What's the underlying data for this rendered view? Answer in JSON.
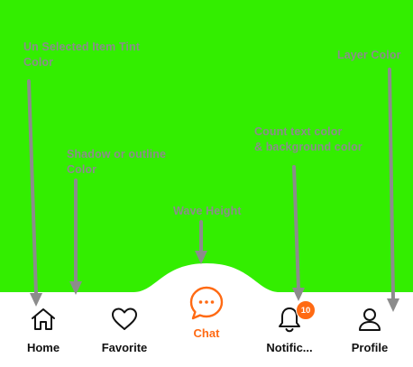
{
  "colors": {
    "layer": "#33ee00",
    "annotation_text": "#8c8c8c",
    "arrow": "#8c8c8c",
    "selected_tint": "#ff6a13",
    "unselected_tint": "#111111",
    "badge_background": "#ff6a13",
    "badge_text": "#ffffff",
    "nav_background": "#ffffff"
  },
  "annotations": {
    "unselected_tint": "Un Selected Item Tint\nColor",
    "shadow_outline": "Shadow or outline\nColor",
    "wave_height": "Wave Height",
    "count_text": "Count text color\n& background color",
    "layer_color": "Layer Color"
  },
  "nav": {
    "selected_index": 2,
    "items": [
      {
        "label": "Home",
        "icon": "home-icon"
      },
      {
        "label": "Favorite",
        "icon": "heart-icon"
      },
      {
        "label": "Chat",
        "icon": "chat-bubble-icon"
      },
      {
        "label": "Notific...",
        "icon": "bell-icon",
        "badge": "10"
      },
      {
        "label": "Profile",
        "icon": "user-icon"
      }
    ]
  }
}
